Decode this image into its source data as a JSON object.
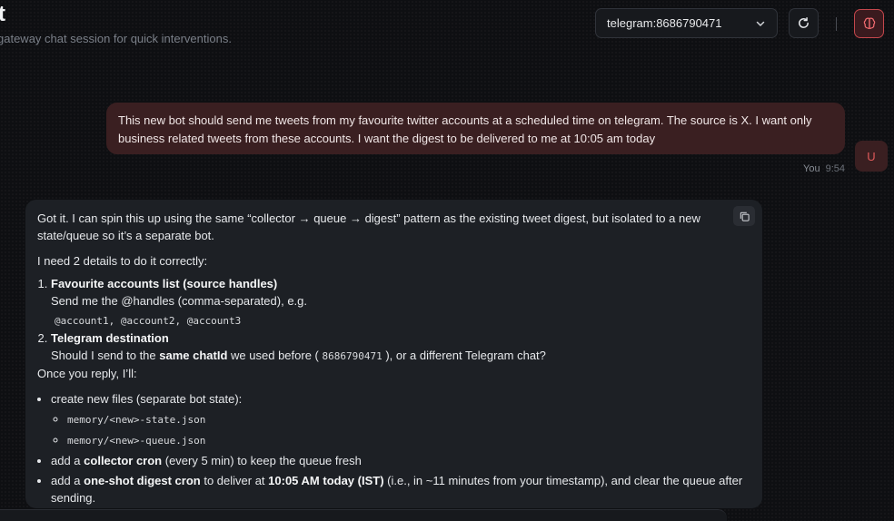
{
  "header": {
    "title": "t",
    "subtitle": "gateway chat session for quick interventions.",
    "session_value": "telegram:8686790471"
  },
  "icons": {
    "select": "chevron-down-icon",
    "refresh": "refresh-icon",
    "brain": "brain-icon",
    "copy": "copy-icon"
  },
  "colors": {
    "accent": "#c4474c",
    "user_bubble": "#3a1f21",
    "bot_bubble": "#1d2025"
  },
  "user_message": {
    "text": "This new bot should send me tweets from my favourite twitter accounts at a scheduled time on telegram. The source is X. I want only business related tweets from these accounts. I want the digest to be delivered to me at 10:05 am today",
    "author": "You",
    "time": "9:54",
    "avatar": "U"
  },
  "bot_message": {
    "p1": "Got it. I can spin this up using the same “collector → queue → digest” pattern as the existing tweet digest, but isolated to a new state/queue so it’s a separate bot.",
    "p2": "I need 2 details to do it correctly:",
    "item1_title": "Favourite accounts list (source handles)",
    "item1_text": "Send me the @handles (comma-separated), e.g.",
    "item1_code": "@account1, @account2, @account3",
    "item2_title": "Telegram destination",
    "item2_pre": "Should I send to the ",
    "item2_bold": "same chatId",
    "item2_mid": " we used before ( ",
    "item2_code": "8686790471",
    "item2_post": " ), or a different Telegram chat?",
    "p3": "Once you reply, I’ll:",
    "b1": "create new files (separate bot state):",
    "b1_file1": "memory/<new>-state.json",
    "b1_file2": "memory/<new>-queue.json",
    "b2_pre": "add a ",
    "b2_bold": "collector cron",
    "b2_post": " (every 5 min) to keep the queue fresh",
    "b3_pre": "add a ",
    "b3_bold": "one-shot digest cron",
    "b3_mid": " to deliver at ",
    "b3_bold2": "10:05 AM today (IST)",
    "b3_post": " (i.e., in ~11 minutes from your timestamp), and clear the queue after sending."
  }
}
